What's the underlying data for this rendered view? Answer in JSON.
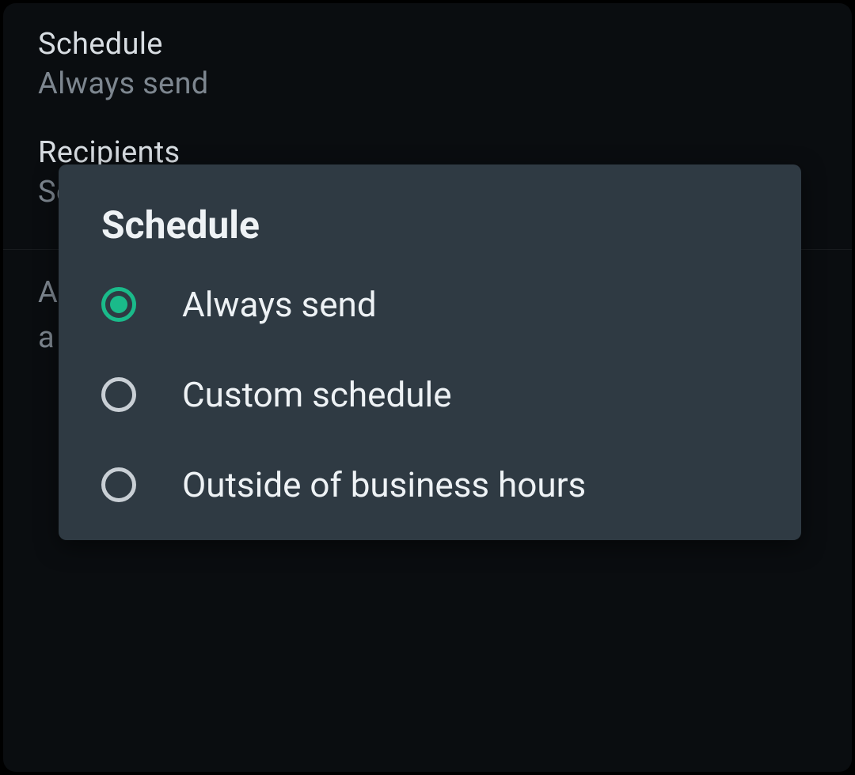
{
  "background": {
    "schedule": {
      "title": "Schedule",
      "value": "Always send"
    },
    "recipients": {
      "title": "Recipients",
      "value": "Se"
    },
    "info_line1": "A",
    "info_line2": "a"
  },
  "dialog": {
    "title": "Schedule",
    "options": [
      {
        "label": "Always send",
        "checked": true
      },
      {
        "label": "Custom schedule",
        "checked": false
      },
      {
        "label": "Outside of business hours",
        "checked": false
      }
    ]
  }
}
